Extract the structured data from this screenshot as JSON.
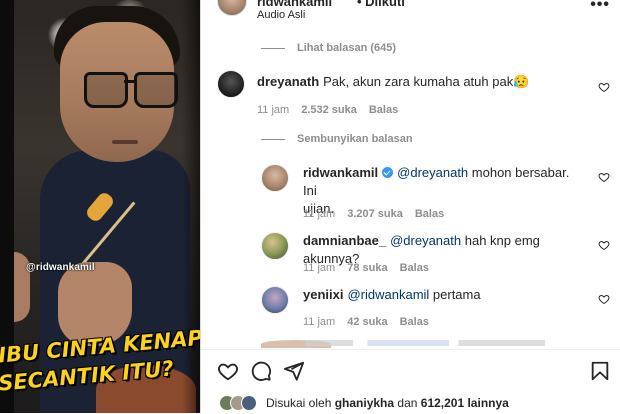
{
  "video": {
    "watermark": "@ridwankamil",
    "caption_line1": "IBU CINTA KENAPA",
    "caption_line2": "SECANTIK ITU?"
  },
  "post": {
    "username": "ridwankamil",
    "follow_label": "• Diikuti",
    "audio": "Audio Asli",
    "more_icon": "more-options-icon"
  },
  "view_replies": "Lihat balasan (645)",
  "comments": [
    {
      "username": "dreyanath",
      "text": "Pak, akun zara kumaha atuh pak😥",
      "time": "11 jam",
      "likes": "2.532 suka",
      "reply": "Balas"
    }
  ],
  "hide_replies": "Sembunyikan balasan",
  "replies": [
    {
      "username": "ridwankamil",
      "verified": true,
      "mention": "@dreyanath",
      "text_line1": " mohon bersabar. Ini",
      "text_line2": "ujian.",
      "time": "11 jam",
      "likes": "3.207 suka",
      "reply": "Balas"
    },
    {
      "username": "damnianbae_",
      "mention": "@dreyanath",
      "text": " hah knp emg akunnya?",
      "time": "11 jam",
      "likes": "78 suka",
      "reply": "Balas"
    },
    {
      "username": "yeniixi",
      "mention": "@ridwankamil",
      "text": " pertama",
      "time": "11 jam",
      "likes": "42 suka",
      "reply": "Balas"
    }
  ],
  "liked_by": {
    "prefix": "Disukai oleh ",
    "user": "ghaniykha",
    "middle": " dan ",
    "count": "612,201 lainnya"
  },
  "colors": {
    "mention": "#00376b",
    "muted": "#8e8e8e",
    "verified": "#3897f0",
    "caption": "#ffd21e"
  }
}
